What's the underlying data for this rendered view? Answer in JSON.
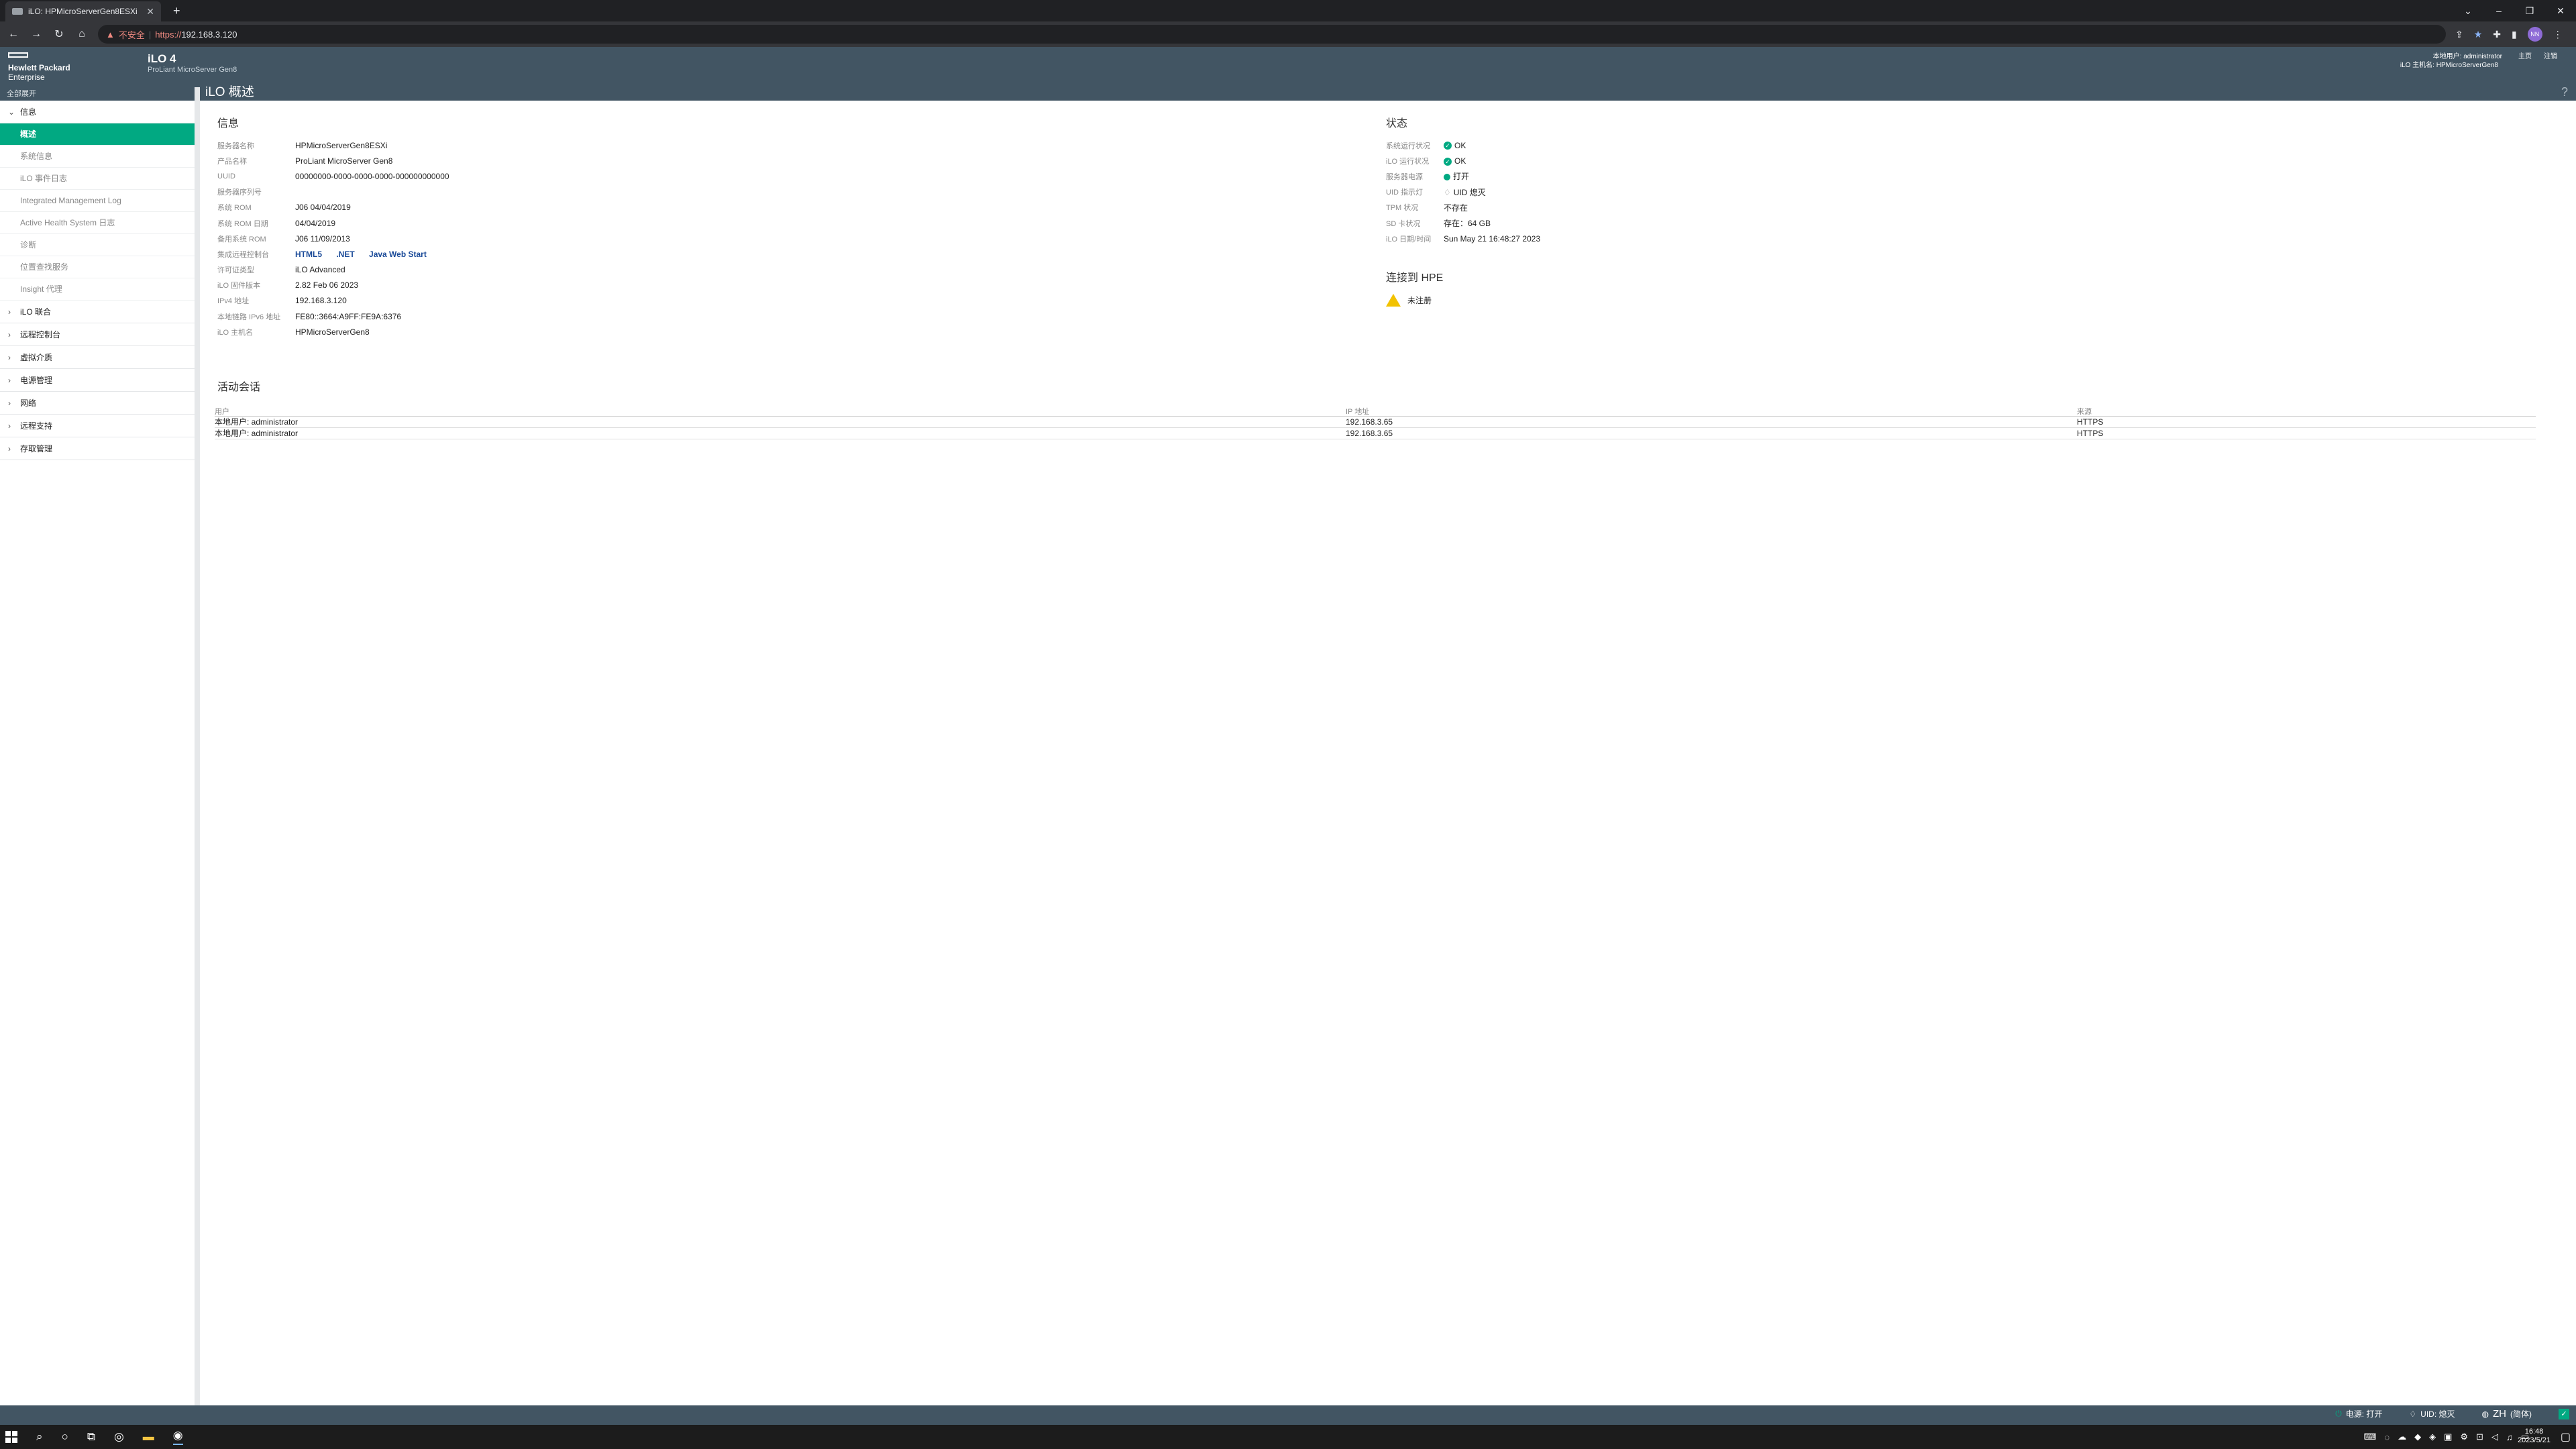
{
  "browser": {
    "tab_title": "iLO: HPMicroServerGen8ESXi",
    "not_secure": "不安全",
    "url_scheme": "https://",
    "url_host": "192.168.3.120",
    "profile": "NN"
  },
  "header": {
    "brand_line1": "Hewlett Packard",
    "brand_line2": "Enterprise",
    "product": "iLO 4",
    "model": "ProLiant MicroServer Gen8",
    "local_user": "本地用户: administrator",
    "ilo_host": "iLO 主机名: HPMicroServerGen8",
    "link_home": "主页",
    "link_logout": "注销"
  },
  "sidebar": {
    "expand_all": "全部展开",
    "info_group": "信息",
    "info_items": [
      "概述",
      "系统信息",
      "iLO 事件日志",
      "Integrated Management Log",
      "Active Health System 日志",
      "诊断",
      "位置查找服务",
      "Insight 代理"
    ],
    "groups": [
      "iLO 联合",
      "远程控制台",
      "虚拟介质",
      "电源管理",
      "网络",
      "远程支持",
      "存取管理"
    ]
  },
  "page": {
    "title": "iLO 概述",
    "help": "?"
  },
  "info": {
    "heading": "信息",
    "server_name_label": "服务器名称",
    "server_name": "HPMicroServerGen8ESXi",
    "product_name_label": "产品名称",
    "product_name": "ProLiant MicroServer Gen8",
    "uuid_label": "UUID",
    "uuid": "00000000-0000-0000-0000-000000000000",
    "serial_label": "服务器序列号",
    "serial": "",
    "rom_label": "系统 ROM",
    "rom": "J06 04/04/2019",
    "rom_date_label": "系统 ROM 日期",
    "rom_date": "04/04/2019",
    "backup_rom_label": "备用系统 ROM",
    "backup_rom": "J06 11/09/2013",
    "console_label": "集成远程控制台",
    "console_html5": "HTML5",
    "console_net": ".NET",
    "console_java": "Java Web Start",
    "license_label": "许可证类型",
    "license": "iLO Advanced",
    "firmware_label": "iLO 固件版本",
    "firmware": "2.82 Feb 06 2023",
    "ipv4_label": "IPv4 地址",
    "ipv4": "192.168.3.120",
    "ipv6_label": "本地链路 IPv6 地址",
    "ipv6": "FE80::3664:A9FF:FE9A:6376",
    "hostname_label": "iLO 主机名",
    "hostname": "HPMicroServerGen8"
  },
  "status": {
    "heading": "状态",
    "sys_health_label": "系统运行状况",
    "sys_health": "OK",
    "ilo_health_label": "iLO 运行状况",
    "ilo_health": "OK",
    "power_label": "服务器电源",
    "power": "打开",
    "uid_label": "UID 指示灯",
    "uid": "UID 熄灭",
    "tpm_label": "TPM 状况",
    "tpm": "不存在",
    "sd_label": "SD 卡状况",
    "sd": "存在：64 GB",
    "date_label": "iLO 日期/时间",
    "date": "Sun May 21 16:48:27 2023"
  },
  "hpe": {
    "heading": "连接到 HPE",
    "unregistered": "未注册"
  },
  "sessions": {
    "heading": "活动会话",
    "columns": [
      "用户",
      "IP 地址",
      "来源"
    ],
    "rows": [
      [
        "本地用户: administrator",
        "192.168.3.65",
        "HTTPS"
      ],
      [
        "本地用户: administrator",
        "192.168.3.65",
        "HTTPS"
      ]
    ]
  },
  "statusbar": {
    "power": "电源: 打开",
    "uid": "UID: 熄灭",
    "lang": "ZH",
    "lang_sub": "(简体)"
  },
  "taskbar": {
    "time": "16:48",
    "date": "2023/5/21"
  }
}
